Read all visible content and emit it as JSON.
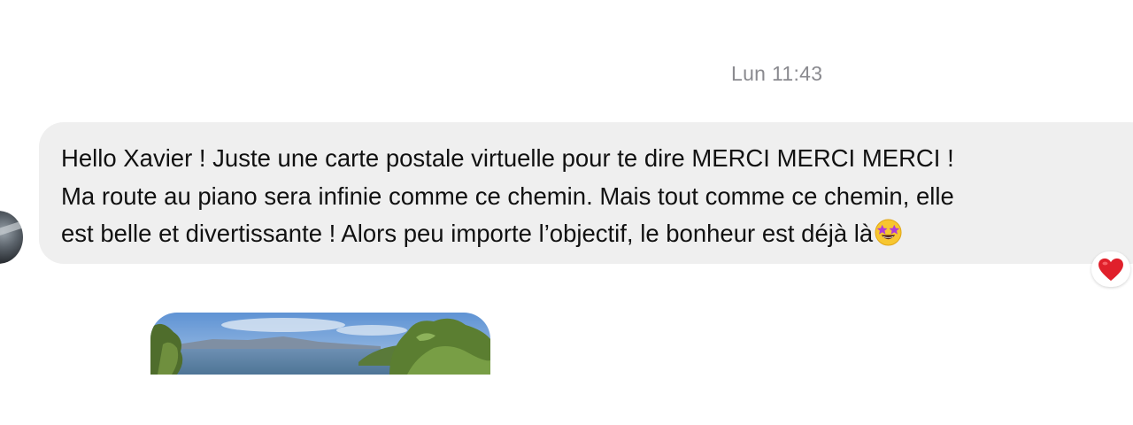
{
  "thread": {
    "timestamp": "Lun 11:43"
  },
  "message": {
    "lines": [
      "Hello Xavier ! Juste une carte postale virtuelle pour te dire MERCI MERCI MERCI !",
      "Ma route au piano sera infinie comme ce chemin. Mais tout comme ce chemin, elle",
      "est belle et divertissante ! Alors peu importe l’objectif, le bonheur est déjà là"
    ],
    "trailing_emoji_icon": "star-struck-emoji-icon",
    "reaction_icon": "red-heart-icon",
    "bubble_color": "#efefef",
    "text_color": "#111111"
  },
  "attachment": {
    "type": "photo",
    "icon": "landscape-photo-icon"
  },
  "colors": {
    "timestamp": "#8a8a8f",
    "reaction_heart": "#e0202b",
    "background": "#ffffff"
  }
}
